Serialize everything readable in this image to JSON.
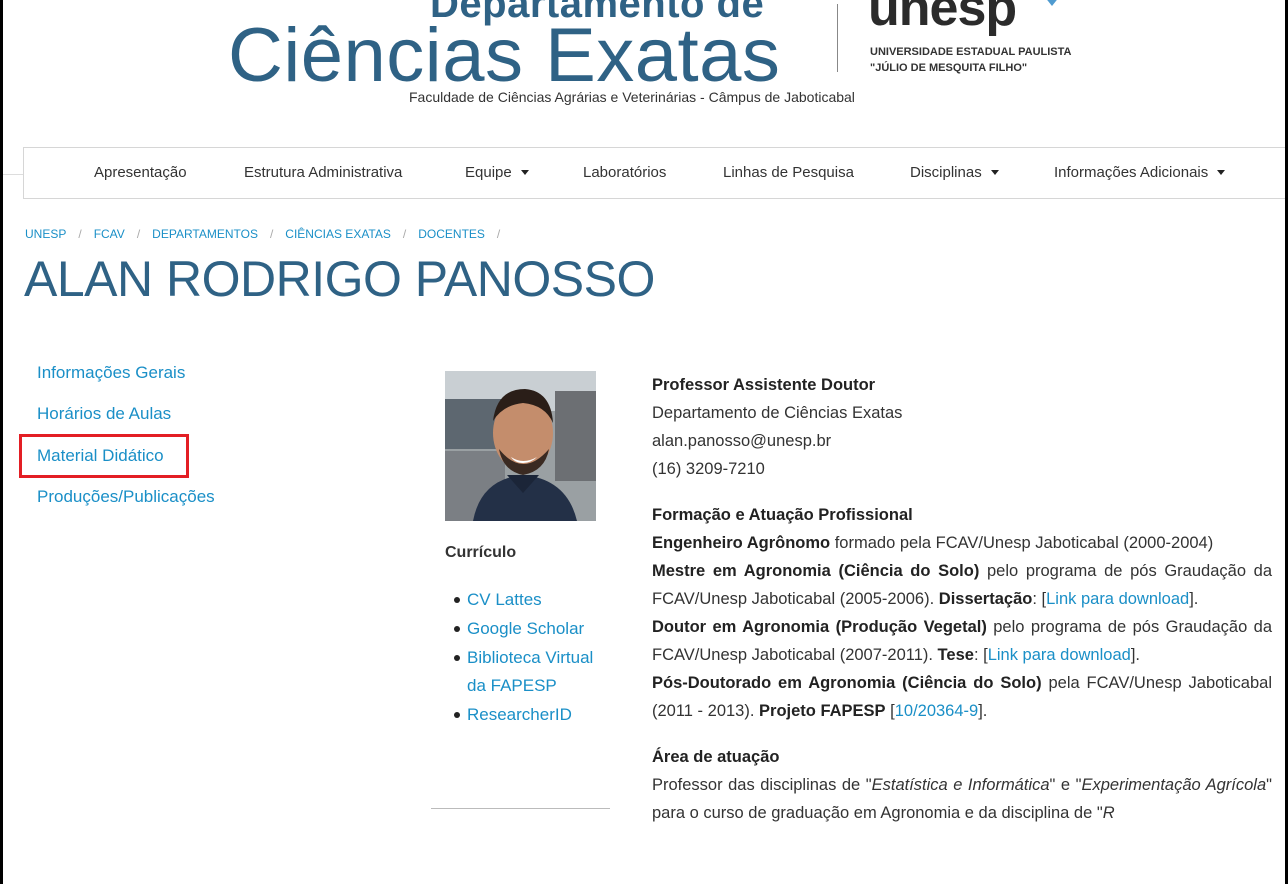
{
  "header": {
    "dept_line1": "Departamento de",
    "dept_line2": "Ciências Exatas",
    "subtitle": "Faculdade de Ciências Agrárias e Veterinárias - Câmpus de Jaboticabal",
    "logo_word": "unesp",
    "logo_line1": "UNIVERSIDADE ESTADUAL PAULISTA",
    "logo_line2": "\"JÚLIO DE MESQUITA FILHO\""
  },
  "nav": {
    "items": [
      {
        "label": "Apresentação"
      },
      {
        "label": "Estrutura Administrativa"
      },
      {
        "label": "Equipe"
      },
      {
        "label": "Laboratórios"
      },
      {
        "label": "Linhas de Pesquisa"
      },
      {
        "label": "Disciplinas"
      },
      {
        "label": "Informações Adicionais"
      }
    ]
  },
  "breadcrumb": [
    "UNESP",
    "FCAV",
    "DEPARTAMENTOS",
    "CIÊNCIAS EXATAS",
    "DOCENTES"
  ],
  "page_title": "ALAN RODRIGO PANOSSO",
  "sidebar": {
    "items": [
      {
        "label": "Informações Gerais"
      },
      {
        "label": "Horários de Aulas"
      },
      {
        "label": "Material Didático"
      },
      {
        "label": "Produções/Publicações"
      }
    ]
  },
  "curriculo": {
    "heading": "Currículo",
    "links": [
      "CV Lattes",
      "Google Scholar",
      "Biblioteca Virtual da FAPESP",
      "ResearcherID"
    ]
  },
  "profile": {
    "role": "Professor Assistente Doutor",
    "department": "Departamento de Ciências Exatas",
    "email": "alan.panosso@unesp.br",
    "phone": "(16) 3209-7210"
  },
  "formacao": {
    "heading": "Formação e Atuação Profissional",
    "eng_bold": "Engenheiro Agrônomo",
    "eng_text": " formado pela FCAV/Unesp Jaboticabal (2000-2004)",
    "mestre_bold": "Mestre em Agronomia (Ciência do Solo)",
    "mestre_text": " pelo programa de pós Graudação da FCAV/Unesp Jaboticabal (2005-2006). ",
    "dissertacao_label": "Dissertação",
    "colon_open": ": [",
    "link_download": "Link para download",
    "close_bracket": "].",
    "doutor_bold": "Doutor em Agronomia (Produção Vegetal)",
    "doutor_text": " pelo programa de pós Graudação da FCAV/Unesp Jaboticabal (2007-2011). ",
    "tese_label": "Tese",
    "posdoc_bold": "Pós-Doutorado em Agronomia (Ciência do Solo)",
    "posdoc_text": " pela FCAV/Unesp Jaboticabal (2011 - 2013). ",
    "fapesp_label": "Projeto FAPESP",
    "fapesp_open": " [",
    "fapesp_link": "10/20364-9",
    "fapesp_close": "]."
  },
  "area": {
    "heading": "Área de atuação",
    "t1": "Professor das disciplinas de \"",
    "i1": "Estatística e Informática",
    "t2": "\" e \"",
    "i2": "Experimentação Agrícola",
    "t3": "\" para o curso de graduação em Agronomia e da disciplina de \"",
    "i3": "R"
  },
  "colors": {
    "accent": "#1a8fc7",
    "title": "#2f6285",
    "highlight": "#e31e24"
  }
}
